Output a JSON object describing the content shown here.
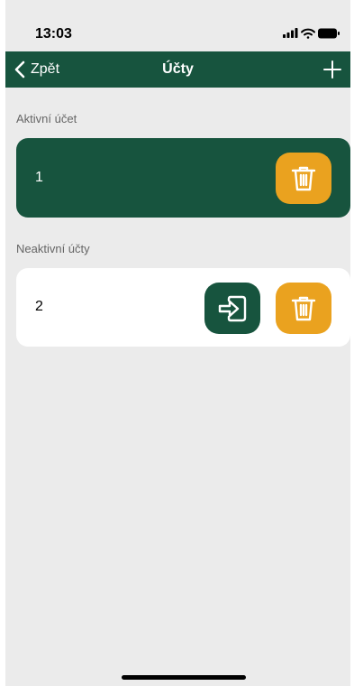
{
  "status_bar": {
    "time": "13:03"
  },
  "nav": {
    "back_label": "Zpět",
    "title": "Účty"
  },
  "active_section": {
    "label": "Aktivní účet",
    "account": {
      "name": "1"
    }
  },
  "inactive_section": {
    "label": "Neaktivní účty",
    "accounts": [
      {
        "name": "2"
      }
    ]
  },
  "icons": {
    "back": "chevron-left-icon",
    "add": "plus-icon",
    "delete": "trash-icon",
    "login": "sign-in-icon",
    "signal": "signal-icon",
    "wifi": "wifi-icon",
    "battery": "battery-icon"
  },
  "colors": {
    "primary_green": "#17543e",
    "accent_orange": "#eaa21f",
    "background": "#ebebeb",
    "card_white": "#ffffff"
  }
}
